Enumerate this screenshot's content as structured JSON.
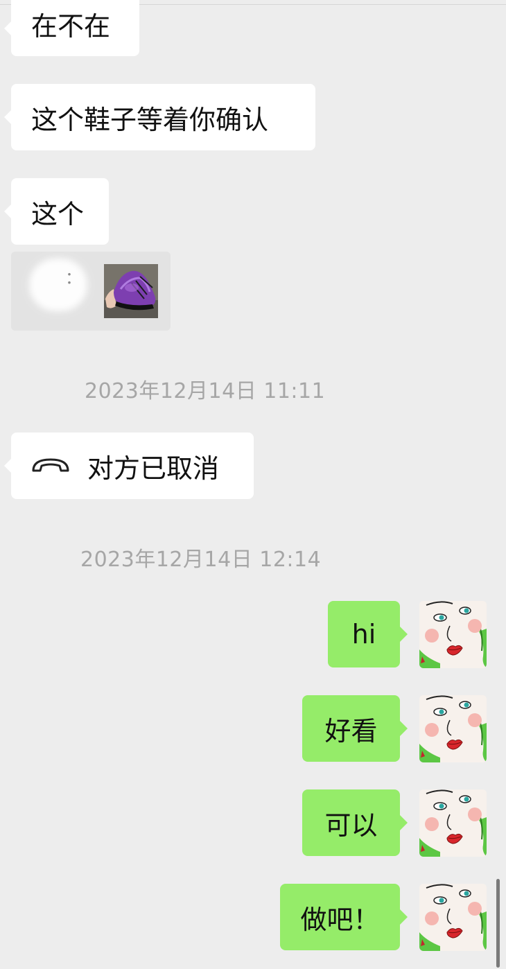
{
  "messages": {
    "m1": "在不在",
    "m2": "这个鞋子等着你确认",
    "m3": "这个",
    "quote_label": "：",
    "call_text": "对方已取消",
    "o1": "hi",
    "o2": "好看",
    "o3": "可以",
    "o4": "做吧！"
  },
  "timestamps": {
    "t1": "2023年12月14日 11:11",
    "t2": "2023年12月14日 12:14"
  },
  "icons": {
    "call": "phone-hangup-icon",
    "thumbnail": "purple-shoe-photo",
    "avatar": "cartoon-face-avatar"
  },
  "colors": {
    "background": "#ededed",
    "incoming_bubble": "#ffffff",
    "outgoing_bubble": "#95ec69",
    "timestamp": "#a6a6a6"
  }
}
